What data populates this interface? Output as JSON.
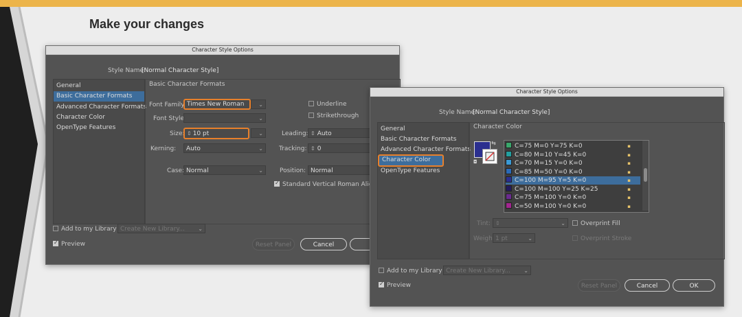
{
  "heading": "Make your changes",
  "dialog1": {
    "title": "Character Style Options",
    "style_name_label": "Style Name:",
    "style_name_value": "[Normal Character Style]",
    "sidebar": [
      "General",
      "Basic Character Formats",
      "Advanced Character Formats",
      "Character Color",
      "OpenType Features"
    ],
    "panel_title": "Basic Character Formats",
    "font_family_label": "Font Family:",
    "font_family_value": "Times New Roman",
    "font_style_label": "Font Style:",
    "size_label": "Size:",
    "size_value": "10 pt",
    "leading_label": "Leading:",
    "leading_value": "Auto",
    "kerning_label": "Kerning:",
    "kerning_value": "Auto",
    "tracking_label": "Tracking:",
    "tracking_value": "0",
    "case_label": "Case:",
    "case_value": "Normal",
    "position_label": "Position:",
    "position_value": "Normal",
    "underline_label": "Underline",
    "strikethrough_label": "Strikethrough",
    "svra_label": "Standard Vertical Roman Alignm",
    "add_library_label": "Add to my Library",
    "library_value": "Create New Library...",
    "preview_label": "Preview",
    "reset_label": "Reset Panel",
    "cancel_label": "Cancel",
    "ok_label": "O"
  },
  "dialog2": {
    "title": "Character Style Options",
    "style_name_label": "Style Name:",
    "style_name_value": "[Normal Character Style]",
    "sidebar": [
      "General",
      "Basic Character Formats",
      "Advanced Character Formats",
      "Character Color",
      "OpenType Features"
    ],
    "panel_title": "Character Color",
    "swatches": [
      {
        "label": "C=75 M=0 Y=75 K=0",
        "color": "#3aa76b"
      },
      {
        "label": "C=80 M=10 Y=45 K=0",
        "color": "#22a0a0"
      },
      {
        "label": "C=70 M=15 Y=0 K=0",
        "color": "#3a9ad6"
      },
      {
        "label": "C=85 M=50 Y=0 K=0",
        "color": "#2a6bb8"
      },
      {
        "label": "C=100 M=95 Y=5 K=0",
        "color": "#2b2f8f"
      },
      {
        "label": "C=100 M=100 Y=25 K=25",
        "color": "#231b5e"
      },
      {
        "label": "C=75 M=100 Y=0 K=0",
        "color": "#6a2b8f"
      },
      {
        "label": "C=50 M=100 Y=0 K=0",
        "color": "#a2268f"
      }
    ],
    "tint_label": "Tint:",
    "tint_value": "",
    "weight_label": "Weight:",
    "weight_value": "1 pt",
    "overprint_fill_label": "Overprint Fill",
    "overprint_stroke_label": "Overprint Stroke",
    "add_library_label": "Add to my Library",
    "library_value": "Create New Library...",
    "preview_label": "Preview",
    "reset_label": "Reset Panel",
    "cancel_label": "Cancel",
    "ok_label": "OK"
  },
  "colors": {
    "accent_highlight": "#e8802b",
    "selection": "#3d6d9c",
    "fill_swatch": "#2b2f8f",
    "gold_bar": "#ecb44a"
  }
}
